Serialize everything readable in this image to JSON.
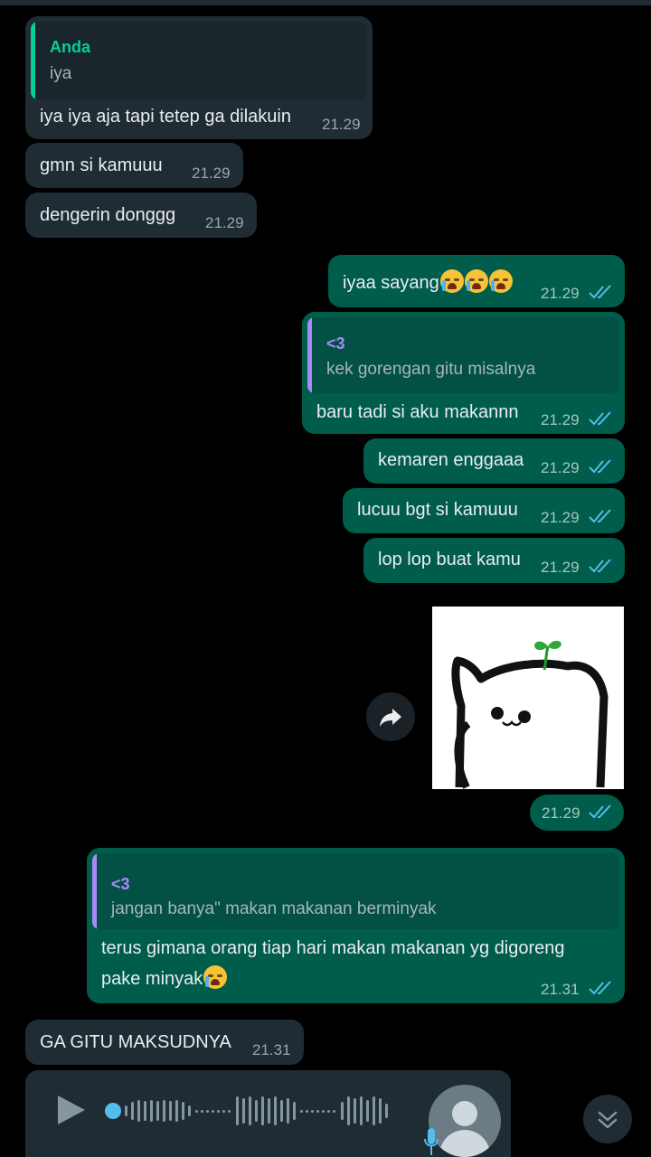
{
  "messages": {
    "m1": {
      "quote_name": "Anda",
      "quote_text": "iya",
      "text": "iya iya aja tapi tetep ga dilakuin",
      "time": "21.29"
    },
    "m2": {
      "text": "gmn si kamuuu",
      "time": "21.29"
    },
    "m3": {
      "text": "dengerin donggg",
      "time": "21.29"
    },
    "m4": {
      "text": "iyaa sayang",
      "time": "21.29",
      "emoji": "loudly-crying-face"
    },
    "m5": {
      "quote_name": "<3",
      "quote_text": "kek gorengan gitu misalnya",
      "text": "baru tadi si aku makannn",
      "time": "21.29"
    },
    "m6": {
      "text": "kemaren enggaaa",
      "time": "21.29"
    },
    "m7": {
      "text": "lucuu bgt si kamuuu",
      "time": "21.29"
    },
    "m8": {
      "text": "lop lop buat kamu",
      "time": "21.29"
    },
    "m9": {
      "sticker": "cat-with-sprout",
      "time": "21.29"
    },
    "m10": {
      "quote_name": "<3",
      "quote_text": "jangan banya\" makan makanan berminyak",
      "text_line1": "terus gimana orang tiap hari makan makanan yg digoreng",
      "text_line2": "pake minyak",
      "time": "21.31"
    },
    "m11": {
      "text": "GA GITU MAKSUDNYA",
      "time": "21.31"
    },
    "m12": {
      "type": "voice-note",
      "icon": "play-icon"
    }
  },
  "colors": {
    "incoming_bubble": "#1f2c34",
    "outgoing_bubble": "#005c4b",
    "read_ticks": "#53bdeb",
    "quote_name_self": "#06cf9c",
    "quote_name_contact": "#a78bfa"
  }
}
